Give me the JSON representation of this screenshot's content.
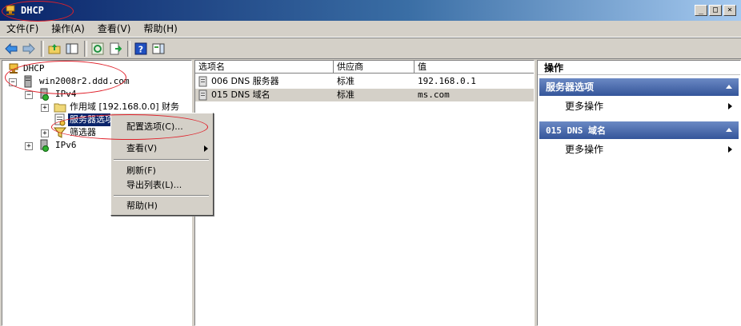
{
  "window": {
    "title": "DHCP"
  },
  "menubar": [
    {
      "label": "文件(F)"
    },
    {
      "label": "操作(A)"
    },
    {
      "label": "查看(V)"
    },
    {
      "label": "帮助(H)"
    }
  ],
  "tree": {
    "root": "DHCP",
    "server": "win2008r2.ddd.com",
    "ipv4": "IPv4",
    "scope": "作用域 [192.168.0.0] 财务",
    "server_options": "服务器选项",
    "filters": "筛选器",
    "ipv6": "IPv6"
  },
  "list": {
    "columns": [
      "选项名",
      "供应商",
      "值"
    ],
    "rows": [
      {
        "name": "006 DNS 服务器",
        "vendor": "标准",
        "value": "192.168.0.1"
      },
      {
        "name": "015 DNS 域名",
        "vendor": "标准",
        "value": "ms.com"
      }
    ]
  },
  "actions": {
    "title": "操作",
    "sections": [
      {
        "header": "服务器选项",
        "item": "更多操作"
      },
      {
        "header": "015 DNS 域名",
        "item": "更多操作"
      }
    ]
  },
  "context_menu": {
    "items": [
      "配置选项(C)...",
      "查看(V)",
      "刷新(F)",
      "导出列表(L)...",
      "帮助(H)"
    ]
  },
  "colors": {
    "selection": "#0a246a",
    "annotation": "#e0202a",
    "action_header": "#34559a"
  }
}
